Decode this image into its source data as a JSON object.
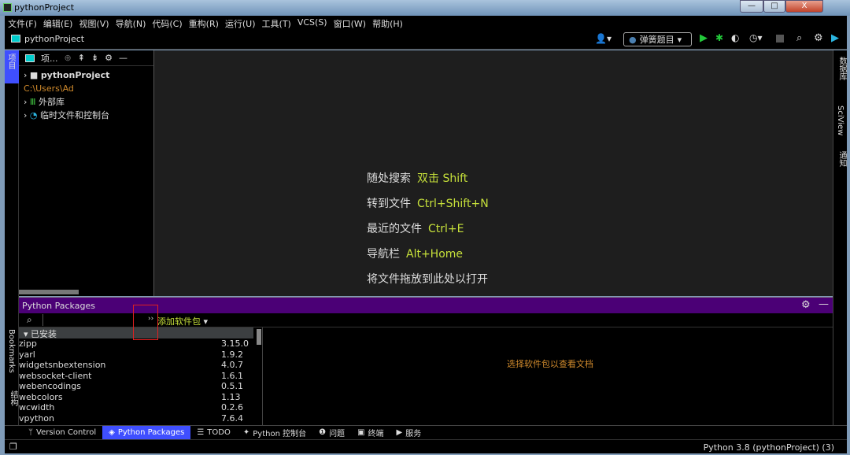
{
  "window": {
    "title": "pythonProject",
    "minimize": "—",
    "maximize": "□",
    "close": "X"
  },
  "menu": [
    "文件(F)",
    "编辑(E)",
    "视图(V)",
    "导航(N)",
    "代码(C)",
    "重构(R)",
    "运行(U)",
    "工具(T)",
    "VCS(S)",
    "窗口(W)",
    "帮助(H)"
  ],
  "navbar": {
    "project": "pythonProject",
    "run_config": "弹簧题目"
  },
  "left_strip": {
    "project": "项目",
    "bookmarks": "Bookmarks",
    "structure": "结构"
  },
  "right_strip": {
    "database": "数据库",
    "sciview": "SciView",
    "notifications": "通知"
  },
  "project_panel": {
    "title": "项...",
    "tree": [
      {
        "label": "pythonProject",
        "path": "C:\\Users\\Ad"
      },
      {
        "label": "外部库"
      },
      {
        "label": "临时文件和控制台"
      }
    ]
  },
  "editor_hints": [
    {
      "label": "随处搜索",
      "shortcut": "双击 Shift"
    },
    {
      "label": "转到文件",
      "shortcut": "Ctrl+Shift+N"
    },
    {
      "label": "最近的文件",
      "shortcut": "Ctrl+E"
    },
    {
      "label": "导航栏",
      "shortcut": "Alt+Home"
    },
    {
      "label": "将文件拖放到此处以打开",
      "shortcut": ""
    }
  ],
  "packages": {
    "title": "Python Packages",
    "search_placeholder": "",
    "more": "››",
    "add_package": "添加软件包",
    "group": "已安装",
    "list": [
      {
        "name": "zipp",
        "version": "3.15.0"
      },
      {
        "name": "yarl",
        "version": "1.9.2"
      },
      {
        "name": "widgetsnbextension",
        "version": "4.0.7"
      },
      {
        "name": "websocket-client",
        "version": "1.6.1"
      },
      {
        "name": "webencodings",
        "version": "0.5.1"
      },
      {
        "name": "webcolors",
        "version": "1.13"
      },
      {
        "name": "wcwidth",
        "version": "0.2.6"
      },
      {
        "name": "vpython",
        "version": "7.6.4"
      }
    ],
    "doc_placeholder": "选择软件包以查看文档"
  },
  "tool_tabs": [
    {
      "label": "Version Control",
      "icon": "vcs-icon"
    },
    {
      "label": "Python Packages",
      "icon": "layers-icon",
      "active": true
    },
    {
      "label": "TODO",
      "icon": "list-icon"
    },
    {
      "label": "Python 控制台",
      "icon": "python-icon"
    },
    {
      "label": "问题",
      "icon": "warning-icon"
    },
    {
      "label": "终端",
      "icon": "terminal-icon"
    },
    {
      "label": "服务",
      "icon": "play-circle-icon"
    }
  ],
  "status": {
    "interpreter": "Python 3.8 (pythonProject) (3)"
  },
  "colors": {
    "accent": "#3f4fff",
    "packages_header": "#4b0076",
    "shortcut": "#c6e03a",
    "path": "#d08a2c",
    "run": "#22c93a"
  }
}
